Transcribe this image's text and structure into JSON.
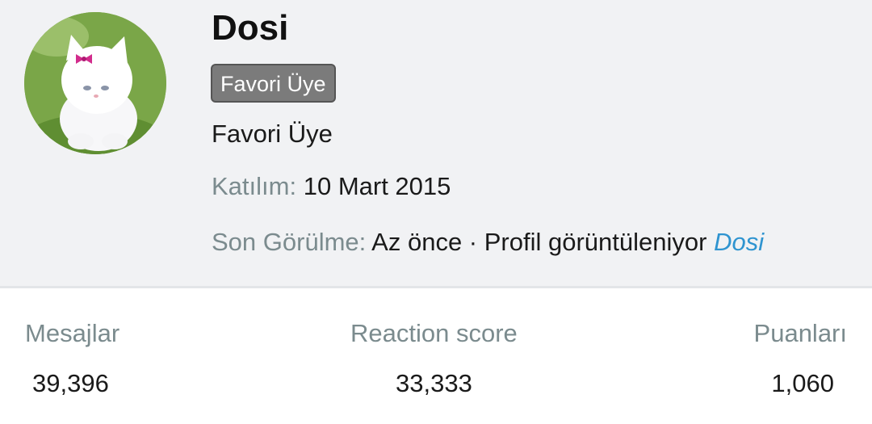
{
  "profile": {
    "username": "Dosi",
    "banner": "Favori Üye",
    "user_title": "Favori Üye",
    "joined": {
      "label": "Katılım:",
      "value": "10 Mart 2015"
    },
    "last_seen": {
      "label": "Son Görülme:",
      "value": "Az önce · Profil görüntüleniyor",
      "link": "Dosi"
    }
  },
  "stats": {
    "messages": {
      "label": "Mesajlar",
      "value": "39,396"
    },
    "reactions": {
      "label": "Reaction score",
      "value": "33,333"
    },
    "points": {
      "label": "Puanları",
      "value": "1,060"
    }
  },
  "colors": {
    "header_bg": "#f1f2f4",
    "badge_bg": "#7b7b7b",
    "label": "#7b8b8e",
    "link": "#2f94d0"
  }
}
